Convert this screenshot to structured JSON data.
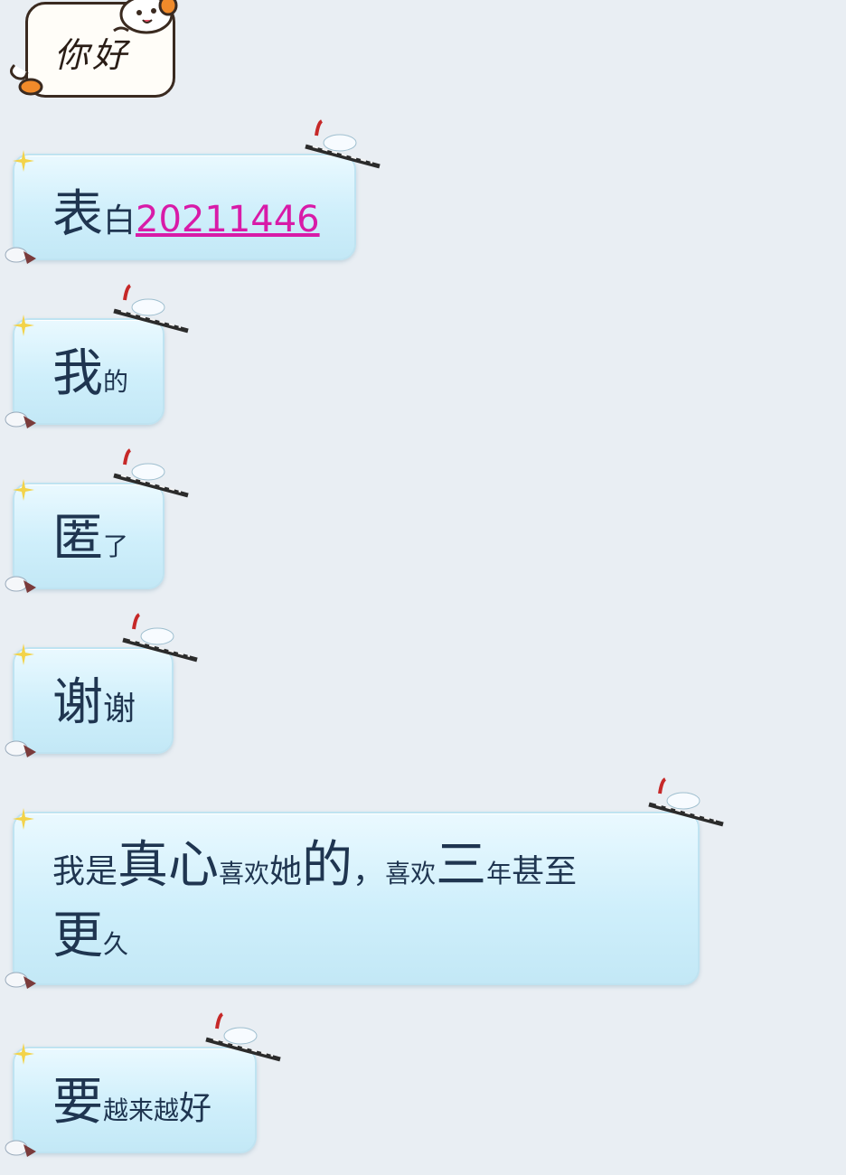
{
  "sticker": {
    "text": "你好"
  },
  "messages": [
    {
      "parts": [
        {
          "text": "表",
          "size": "big"
        },
        {
          "text": "白",
          "size": "mid"
        },
        {
          "text": "20211446",
          "size": "link"
        }
      ]
    },
    {
      "parts": [
        {
          "text": "我",
          "size": "big"
        },
        {
          "text": "的",
          "size": "sm"
        }
      ]
    },
    {
      "parts": [
        {
          "text": "匿",
          "size": "big"
        },
        {
          "text": "了",
          "size": "sm"
        }
      ]
    },
    {
      "parts": [
        {
          "text": "谢",
          "size": "big"
        },
        {
          "text": "谢",
          "size": "mid"
        }
      ]
    },
    {
      "line1": [
        {
          "text": "我是",
          "size": "mid"
        },
        {
          "text": "真心",
          "size": "big"
        },
        {
          "text": "喜欢",
          "size": "sm"
        },
        {
          "text": "她",
          "size": "mid"
        },
        {
          "text": "的",
          "size": "big"
        },
        {
          "text": "，",
          "size": "mid"
        },
        {
          "text": "喜欢",
          "size": "sm"
        },
        {
          "text": "三",
          "size": "big"
        },
        {
          "text": "年",
          "size": "sm"
        },
        {
          "text": "甚至",
          "size": "mid"
        }
      ],
      "line2": [
        {
          "text": "更",
          "size": "big"
        },
        {
          "text": "久",
          "size": "sm"
        }
      ]
    },
    {
      "parts": [
        {
          "text": "要",
          "size": "big"
        },
        {
          "text": "越来越",
          "size": "sm"
        },
        {
          "text": "好",
          "size": "mid"
        }
      ]
    }
  ],
  "colors": {
    "bubble_top": "#eaf9ff",
    "bubble_bottom": "#c3e8f6",
    "link": "#d81ba8",
    "text": "#1f3550",
    "background": "#e9eef3"
  }
}
